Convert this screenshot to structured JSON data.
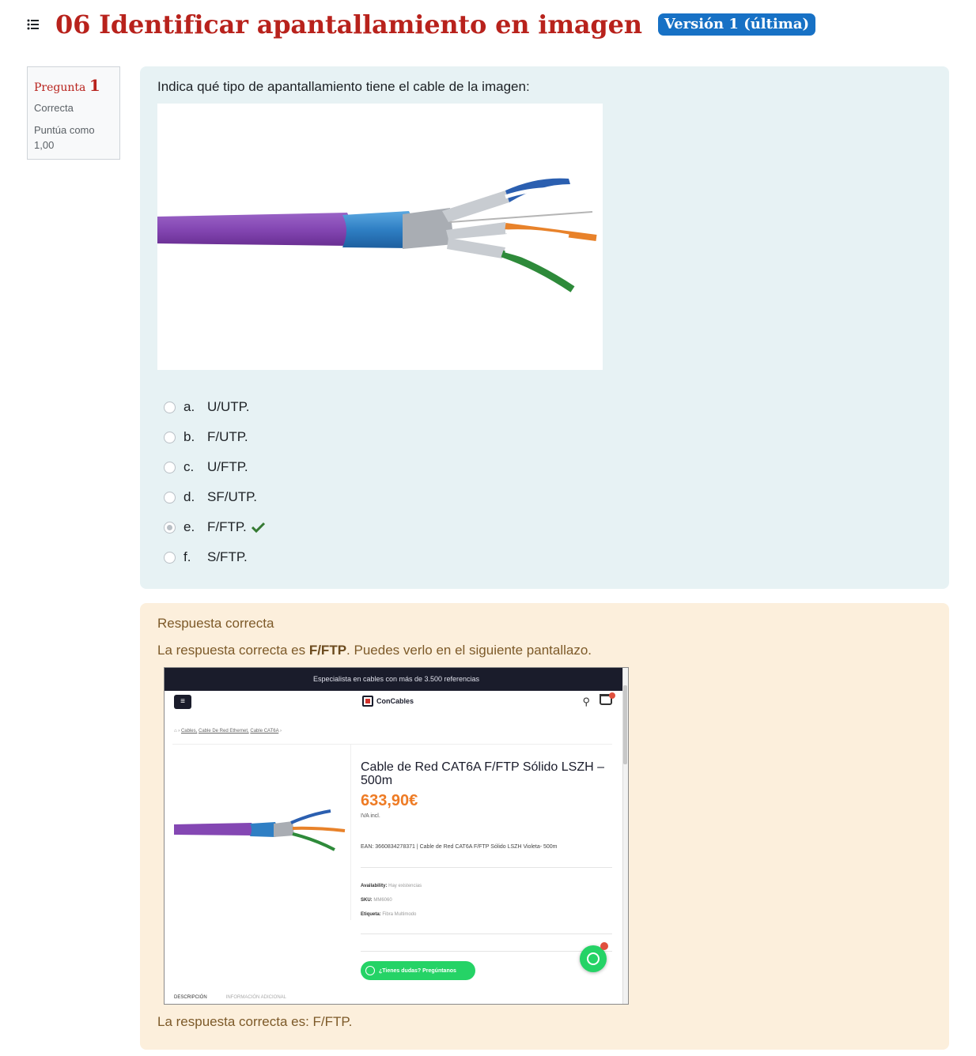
{
  "header": {
    "title": "06 Identificar apantallamiento en imagen",
    "version_badge": "Versión 1 (última)",
    "icon": "list-icon"
  },
  "question_info": {
    "label": "Pregunta",
    "number": "1",
    "state": "Correcta",
    "grade_line1": "Puntúa como",
    "grade_line2": "1,00"
  },
  "question": {
    "text": "Indica qué tipo de apantallamiento tiene el cable de la imagen:",
    "answers": [
      {
        "letter": "a.",
        "text": "U/UTP.",
        "selected": false
      },
      {
        "letter": "b.",
        "text": "F/UTP.",
        "selected": false
      },
      {
        "letter": "c.",
        "text": "U/FTP.",
        "selected": false
      },
      {
        "letter": "d.",
        "text": "SF/UTP.",
        "selected": false
      },
      {
        "letter": "e.",
        "text": "F/FTP.",
        "selected": true,
        "correct": true
      },
      {
        "letter": "f.",
        "text": "S/FTP.",
        "selected": false
      }
    ]
  },
  "feedback": {
    "title": "Respuesta correcta",
    "line_prefix": "La respuesta correcta es ",
    "line_bold": "F/FTP",
    "line_suffix": ". Puedes verlo en el siguiente pantallazo.",
    "final": "La respuesta correcta es: F/FTP."
  },
  "screenshot": {
    "topbar": "Especialista en cables con más de 3.500 referencias",
    "menu_glyph": "≡",
    "logo": "ConCables",
    "search_glyph": "⚲",
    "breadcrumb_home": "⌂ ›",
    "breadcrumb_1": "Cables,",
    "breadcrumb_2": "Cable De Red Ethernet,",
    "breadcrumb_3": "Cable CAT6A",
    "breadcrumb_end": "›",
    "product_title": "Cable de Red CAT6A F/FTP Sólido LSZH – 500m",
    "price": "633,90€",
    "tax": "IVA incl.",
    "ean": "EAN: 3660834278371 | Cable de Red CAT6A F/FTP Sólido LSZH Violeta- 500m",
    "availability_label": "Availability:",
    "availability_value": "Hay existencias",
    "sku_label": "SKU:",
    "sku_value": "MM6060",
    "tag_label": "Etiqueta:",
    "tag_value": "Fibra Multimodo",
    "ask_button": "¿Tienes dudas? Pregúntanos",
    "tab_1": "DESCRIPCIÓN",
    "tab_2": "INFORMACIÓN ADICIONAL"
  },
  "colors": {
    "title_red": "#b8221c",
    "badge_blue": "#1771c5",
    "question_bg": "#e7f2f4",
    "feedback_bg": "#fcefdc",
    "check_green": "#357a32",
    "cable_purple": "#8a4fb6",
    "shield_blue": "#3b8fd4"
  }
}
